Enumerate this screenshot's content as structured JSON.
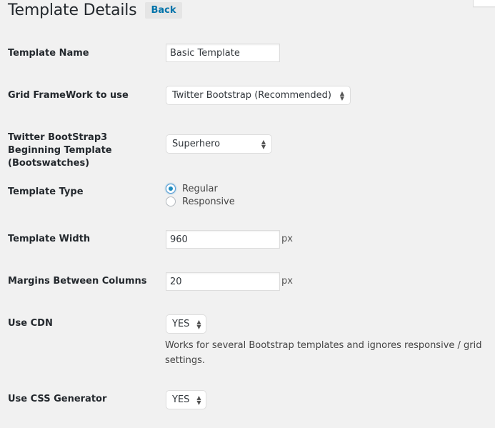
{
  "header": {
    "title": "Template Details",
    "back_label": "Back"
  },
  "fields": {
    "template_name": {
      "label": "Template Name",
      "value": "Basic Template"
    },
    "grid_framework": {
      "label": "Grid FrameWork to use",
      "selected": "Twitter Bootstrap (Recommended)"
    },
    "bootswatch": {
      "label": "Twitter BootStrap3 Beginning Template (Bootswatches)",
      "selected": "Superhero"
    },
    "template_type": {
      "label": "Template Type",
      "options": [
        "Regular",
        "Responsive"
      ],
      "selected": "Regular"
    },
    "template_width": {
      "label": "Template Width",
      "value": "960",
      "unit": "px"
    },
    "margins": {
      "label": "Margins Between Columns",
      "value": "20",
      "unit": "px"
    },
    "use_cdn": {
      "label": "Use CDN",
      "selected": "YES",
      "help": "Works for several Bootstrap templates and ignores responsive / grid settings."
    },
    "use_css_generator": {
      "label": "Use CSS Generator",
      "selected": "YES"
    }
  }
}
